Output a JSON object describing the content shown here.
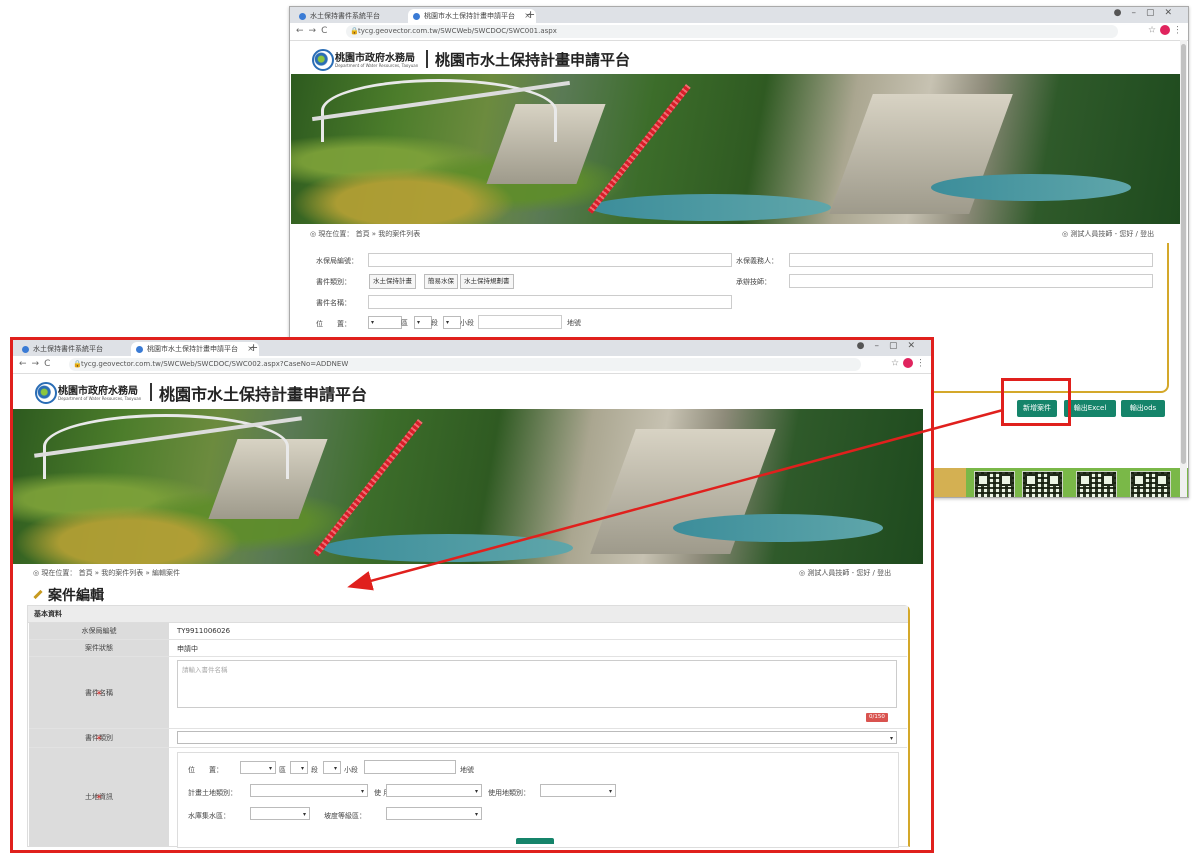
{
  "back_window": {
    "tabs": [
      {
        "label": "水土保持書件系統平台"
      },
      {
        "label": "桃園市水土保持計畫申請平台"
      }
    ],
    "url": "tycg.geovector.com.tw/SWCWeb/SWCDOC/SWC001.aspx",
    "site": {
      "org_cn": "桃園市政府水務局",
      "org_en": "Department of Water Resources, Taoyuan",
      "title": "桃園市水土保持計畫申請平台"
    },
    "breadcrumb": "現在位置： 首頁 » 我的案件列表",
    "user": "測試人員技師 - 您好 / 登出",
    "filters": {
      "case_no_label": "水保局編號：",
      "applicant_label": "水保義務人：",
      "case_type_label": "書件類別：",
      "type_buttons": [
        "水土保持計畫",
        "簡易水保",
        "水土保持規劃書"
      ],
      "professional_label": "承辦技師：",
      "case_name_label": "書件名稱：",
      "location_label": "位　　置：",
      "location_parts": [
        "區",
        "段",
        "小段",
        "地號"
      ]
    },
    "buttons": {
      "new_case": "新增案件",
      "export_excel": "輸出Excel",
      "export_ods": "輸出ods"
    }
  },
  "front_window": {
    "tabs": [
      {
        "label": "水土保持書件系統平台"
      },
      {
        "label": "桃園市水土保持計畫申請平台"
      }
    ],
    "url": "tycg.geovector.com.tw/SWCWeb/SWCDOC/SWC002.aspx?CaseNo=ADDNEW",
    "site": {
      "org_cn": "桃園市政府水務局",
      "org_en": "Department of Water Resources, Taoyuan",
      "title": "桃園市水土保持計畫申請平台"
    },
    "breadcrumb": "現在位置： 首頁 » 我的案件列表 » 編輯案件",
    "user": "測試人員技師 - 您好 / 登出",
    "page_title": "案件編輯",
    "section_title": "基本資料",
    "rows": {
      "case_no_label": "水保局編號",
      "case_no_value": "TY9911006026",
      "status_label": "案件狀態",
      "status_value": "申請中",
      "case_name_label": "書件名稱",
      "case_name_placeholder": "請輸入書件名稱",
      "char_counter": "0/150",
      "case_type_label": "書件類別",
      "land_info_label": "土地資訊",
      "location_label": "位　　置：",
      "district_suffix": "區",
      "section_suffix": "段",
      "subsection_suffix": "小段",
      "lot_suffix": "地號",
      "planned_land_label": "計畫土地類別：",
      "zoning_label": "使 用 分 區：",
      "land_use_label": "使用地類別：",
      "reservoir_label": "水庫集水區：",
      "slope_label": "坡度等級區："
    }
  }
}
